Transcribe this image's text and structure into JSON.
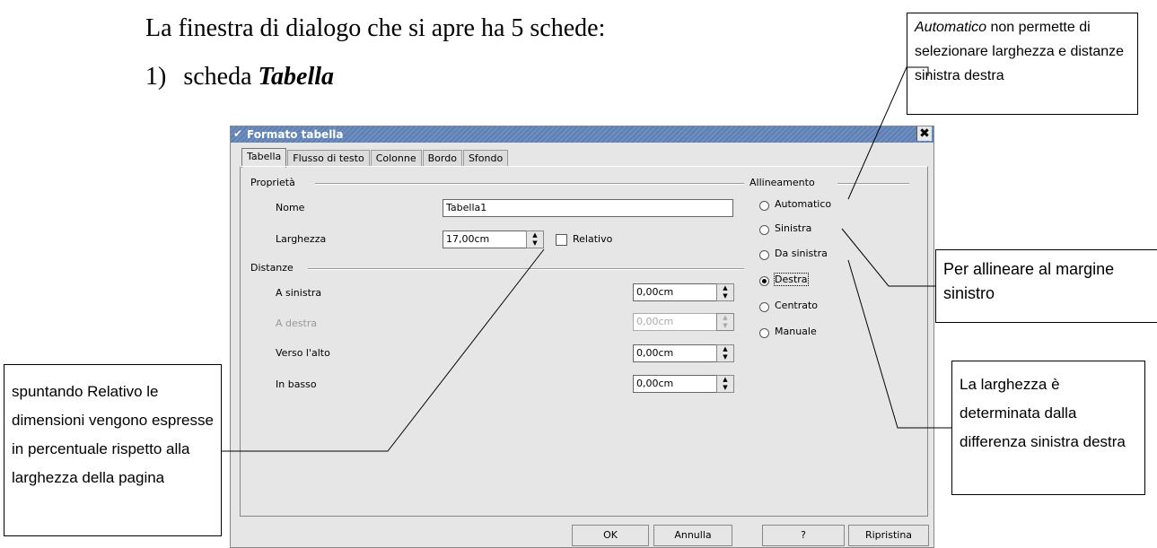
{
  "document": {
    "intro": "La finestra di dialogo che si apre ha 5 schede:",
    "item_number": "1)",
    "item_prefix": "scheda ",
    "item_emphasis": "Tabella"
  },
  "callouts": {
    "automatico_em": "Automatico",
    "automatico_rest": " non permette di selezionare larghezza e distanze sinistra destra",
    "sinistra": "Per allineare al margine sinistro",
    "relativo": "spuntando Relativo le dimensioni vengono espresse in percentuale rispetto alla larghezza della pagina",
    "da_sinistra": "La larghezza è determinata dalla differenza sinistra destra"
  },
  "dialog": {
    "title": "Formato tabella",
    "tabs": [
      "Tabella",
      "Flusso di testo",
      "Colonne",
      "Bordo",
      "Sfondo"
    ],
    "properties": {
      "group": "Proprietà",
      "name_label": "Nome",
      "name_value": "Tabella1",
      "width_label": "Larghezza",
      "width_value": "17,00cm",
      "relative_label": "Relativo"
    },
    "spacing": {
      "group": "Distanze",
      "left_label": "A sinistra",
      "left_value": "0,00cm",
      "right_label": "A destra",
      "right_value": "0,00cm",
      "top_label": "Verso l'alto",
      "top_value": "0,00cm",
      "bottom_label": "In basso",
      "bottom_value": "0,00cm"
    },
    "alignment": {
      "group": "Allineamento",
      "options": [
        "Automatico",
        "Sinistra",
        "Da sinistra",
        "Destra",
        "Centrato",
        "Manuale"
      ],
      "selected": "Destra"
    },
    "buttons": {
      "ok": "OK",
      "cancel": "Annulla",
      "help": "?",
      "reset": "Ripristina"
    }
  }
}
